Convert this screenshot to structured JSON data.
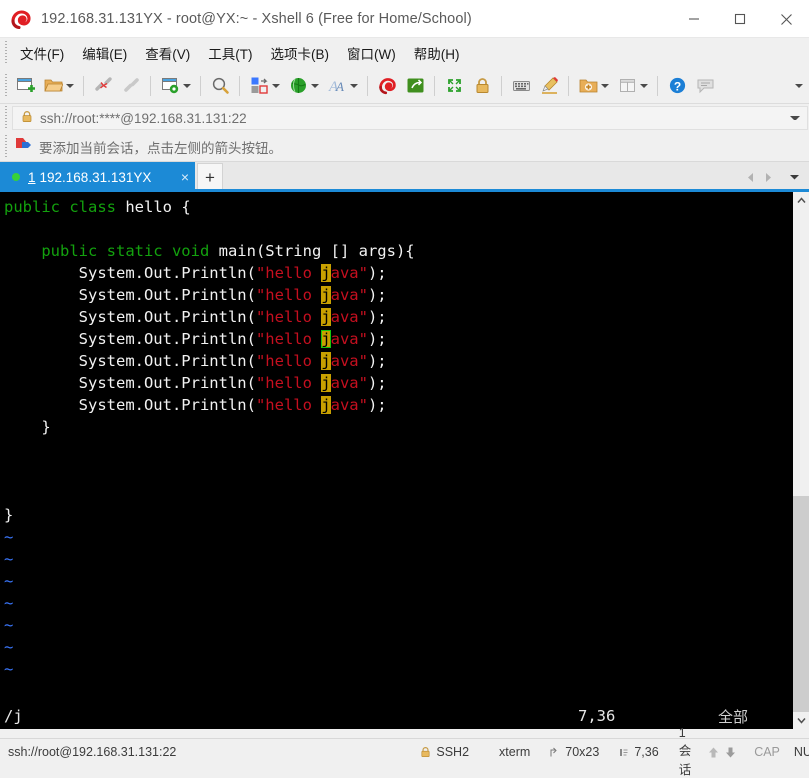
{
  "window": {
    "title": "192.168.31.131YX - root@YX:~ - Xshell 6 (Free for Home/School)",
    "logo_name": "xshell-logo-icon",
    "minimize_label": "–",
    "maximize_label": "□",
    "close_label": "✕"
  },
  "menu": {
    "items": [
      {
        "label": "文件(F)",
        "name": "menu-file"
      },
      {
        "label": "编辑(E)",
        "name": "menu-edit"
      },
      {
        "label": "查看(V)",
        "name": "menu-view"
      },
      {
        "label": "工具(T)",
        "name": "menu-tools"
      },
      {
        "label": "选项卡(B)",
        "name": "menu-tabs"
      },
      {
        "label": "窗口(W)",
        "name": "menu-window"
      },
      {
        "label": "帮助(H)",
        "name": "menu-help"
      }
    ]
  },
  "toolbar": {
    "icons": [
      "new-session-icon",
      "open-folder-icon",
      "disconnect-icon",
      "reconnect-icon",
      "session-properties-icon",
      "find-icon",
      "transfer-file-icon",
      "globe-icon",
      "font-icon",
      "xshell-icon",
      "xftp-icon",
      "fullscreen-icon",
      "lock-icon",
      "keyboard-icon",
      "highlight-icon",
      "add-folder-icon",
      "layout-icon",
      "help-icon",
      "comment-icon"
    ],
    "overflow_name": "toolbar-overflow-icon"
  },
  "address": {
    "value": "ssh://root:****@192.168.31.131:22",
    "lock_icon": "lock-icon",
    "dropdown_icon": "chevron-down-icon"
  },
  "notification": {
    "icon": "add-session-arrow-icon",
    "text": "要添加当前会话，点击左侧的箭头按钮。"
  },
  "tabs": {
    "active": {
      "number": "1",
      "label": "192.168.31.131YX",
      "status_dot_color": "#37d13a",
      "close_label": "×"
    },
    "new_tab_label": "+",
    "prev_icon": "chevron-left-icon",
    "next_icon": "chevron-right-icon",
    "list_icon": "chevron-down-icon"
  },
  "terminal": {
    "lines": [
      [
        {
          "t": "public class ",
          "c": "g"
        },
        {
          "t": "hello {",
          "c": "w"
        }
      ],
      [
        {
          "t": "",
          "c": "w"
        }
      ],
      [
        {
          "t": "    public static void ",
          "c": "g"
        },
        {
          "t": "main(String [] args){",
          "c": "w"
        }
      ],
      [
        {
          "t": "        System.Out.Println(",
          "c": "w"
        },
        {
          "t": "\"hello ",
          "c": "r"
        },
        {
          "t": "j",
          "c": "hl"
        },
        {
          "t": "ava\"",
          "c": "r"
        },
        {
          "t": ");",
          "c": "w"
        }
      ],
      [
        {
          "t": "        System.Out.Println(",
          "c": "w"
        },
        {
          "t": "\"hello ",
          "c": "r"
        },
        {
          "t": "j",
          "c": "hl"
        },
        {
          "t": "ava\"",
          "c": "r"
        },
        {
          "t": ");",
          "c": "w"
        }
      ],
      [
        {
          "t": "        System.Out.Println(",
          "c": "w"
        },
        {
          "t": "\"hello ",
          "c": "r"
        },
        {
          "t": "j",
          "c": "hl"
        },
        {
          "t": "ava\"",
          "c": "r"
        },
        {
          "t": ");",
          "c": "w"
        }
      ],
      [
        {
          "t": "        System.Out.Println(",
          "c": "w"
        },
        {
          "t": "\"hello ",
          "c": "r"
        },
        {
          "t": "j",
          "c": "hl-cur"
        },
        {
          "t": "ava\"",
          "c": "r"
        },
        {
          "t": ");",
          "c": "w"
        }
      ],
      [
        {
          "t": "        System.Out.Println(",
          "c": "w"
        },
        {
          "t": "\"hello ",
          "c": "r"
        },
        {
          "t": "j",
          "c": "hl"
        },
        {
          "t": "ava\"",
          "c": "r"
        },
        {
          "t": ");",
          "c": "w"
        }
      ],
      [
        {
          "t": "        System.Out.Println(",
          "c": "w"
        },
        {
          "t": "\"hello ",
          "c": "r"
        },
        {
          "t": "j",
          "c": "hl"
        },
        {
          "t": "ava\"",
          "c": "r"
        },
        {
          "t": ");",
          "c": "w"
        }
      ],
      [
        {
          "t": "        System.Out.Println(",
          "c": "w"
        },
        {
          "t": "\"hello ",
          "c": "r"
        },
        {
          "t": "j",
          "c": "hl"
        },
        {
          "t": "ava\"",
          "c": "r"
        },
        {
          "t": ");",
          "c": "w"
        }
      ],
      [
        {
          "t": "    }",
          "c": "w"
        }
      ],
      [
        {
          "t": "",
          "c": "w"
        }
      ],
      [
        {
          "t": "",
          "c": "w"
        }
      ],
      [
        {
          "t": "",
          "c": "w"
        }
      ],
      [
        {
          "t": "}",
          "c": "w"
        }
      ],
      [
        {
          "t": "~",
          "c": "b"
        }
      ],
      [
        {
          "t": "~",
          "c": "b"
        }
      ],
      [
        {
          "t": "~",
          "c": "b"
        }
      ],
      [
        {
          "t": "~",
          "c": "b"
        }
      ],
      [
        {
          "t": "~",
          "c": "b"
        }
      ],
      [
        {
          "t": "~",
          "c": "b"
        }
      ],
      [
        {
          "t": "~",
          "c": "b"
        }
      ]
    ],
    "status": {
      "command": "/j",
      "position": "7,36",
      "scroll_state": "全部"
    }
  },
  "statusbar": {
    "connection": "ssh://root@192.168.31.131:22",
    "security_icon": "lock-icon",
    "security": "SSH2",
    "term_type": "xterm",
    "size_icon": "resize-icon",
    "size": "70x23",
    "cursor_icon": "cursor-icon",
    "cursor": "7,36",
    "sessions": "1 会话",
    "up_icon": "arrow-up-icon",
    "down_icon": "arrow-down-icon",
    "cap": "CAP",
    "num": "NUM",
    "grip_icon": "resize-grip-icon"
  },
  "colors": {
    "accent": "#1c8ad6",
    "terminal_bg": "#000000",
    "keyword_green": "#13a10e",
    "string_red": "#c50f1f",
    "tilde_blue": "#3b78ff",
    "highlight_yellow": "#c8a000",
    "cursor_outline": "#16c60c"
  }
}
